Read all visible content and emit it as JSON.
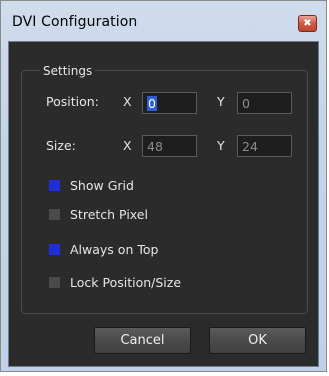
{
  "window": {
    "title": "DVI Configuration",
    "close_glyph": "✖"
  },
  "settings": {
    "group_label": "Settings",
    "position": {
      "label": "Position:",
      "x_label": "X",
      "x_value": "0",
      "y_label": "Y",
      "y_value": "0"
    },
    "size": {
      "label": "Size:",
      "x_label": "X",
      "x_value": "48",
      "y_label": "Y",
      "y_value": "24"
    },
    "options": [
      {
        "label": "Show Grid",
        "checked": true
      },
      {
        "label": "Stretch Pixel",
        "checked": false
      },
      {
        "label": "Always on Top",
        "checked": true
      },
      {
        "label": "Lock Position/Size",
        "checked": false
      }
    ]
  },
  "buttons": {
    "cancel": "Cancel",
    "ok": "OK"
  },
  "colors": {
    "checkbox_on": "#1d2fd6",
    "checkbox_off": "#4a4a4a",
    "panel_bg": "#2b2b2b",
    "selection": "#2f5fcf"
  }
}
